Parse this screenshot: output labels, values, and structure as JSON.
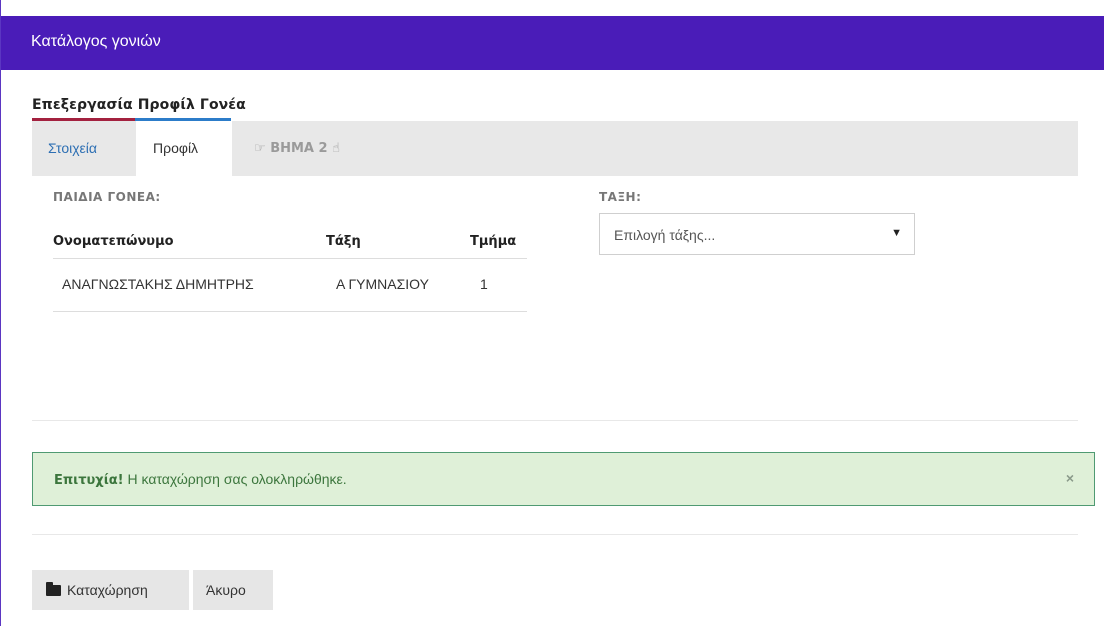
{
  "header": {
    "title": "Κατάλογος γονιών"
  },
  "panel": {
    "title": "Επεξεργασία Προφίλ Γονέα"
  },
  "tabs": {
    "details": "Στοιχεία",
    "profile": "Προφίλ",
    "step": "ΒΗΜΑ 2",
    "step_icon_left": "☞",
    "step_icon_right": "☝"
  },
  "children": {
    "label": "ΠΑΙΔΙΑ ΓΟΝΕΑ:",
    "columns": [
      "Ονοματεπώνυμο",
      "Τάξη",
      "Τμήμα"
    ],
    "rows": [
      {
        "name": "ΑΝΑΓΝΩΣΤΑΚΗΣ ΔΗΜΗΤΡΗΣ",
        "class": "Α ΓΥΜΝΑΣΙΟΥ",
        "section": "1"
      }
    ]
  },
  "class_select": {
    "label": "ΤΑΞΗ:",
    "placeholder": "Επιλογή τάξης...",
    "arrow": "▼"
  },
  "alert": {
    "strong": "Επιτυχία!",
    "message": " Η καταχώρηση σας ολοκληρώθηκε.",
    "close": "×",
    "color": "#3c763d",
    "background": "#dff0d8"
  },
  "actions": {
    "save": "Καταχώρηση",
    "cancel": "Άκυρο"
  },
  "colors": {
    "header": "#4a1cb8",
    "link": "#2d6fb3"
  }
}
